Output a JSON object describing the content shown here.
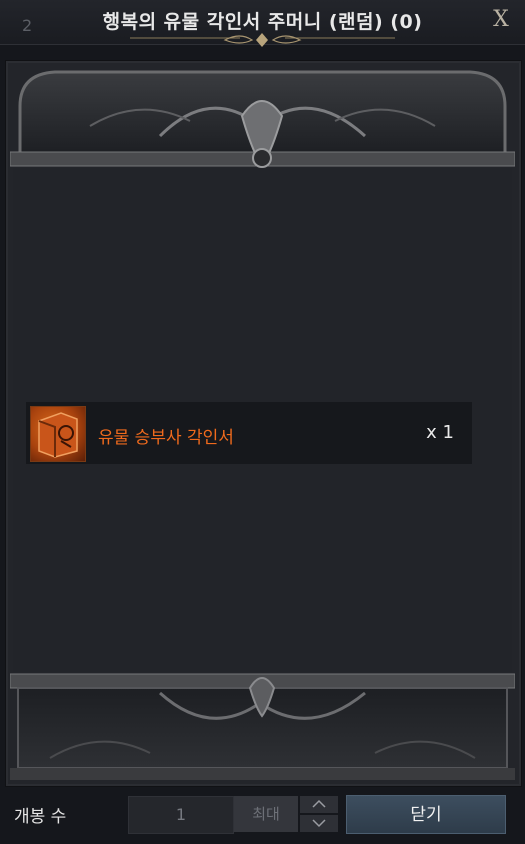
{
  "window": {
    "tab_number": "2",
    "title": "행복의 유물 각인서 주머니 (랜덤) (0)",
    "close_label": "X"
  },
  "rewards": [
    {
      "name": "유물 승부사 각인서",
      "quantity": "x 1",
      "icon": "engraving-book-icon",
      "name_color": "#f06a1c"
    }
  ],
  "footer": {
    "open_count_label": "개봉 수",
    "quantity_value": "1",
    "max_label": "최대",
    "close_button_label": "닫기"
  }
}
